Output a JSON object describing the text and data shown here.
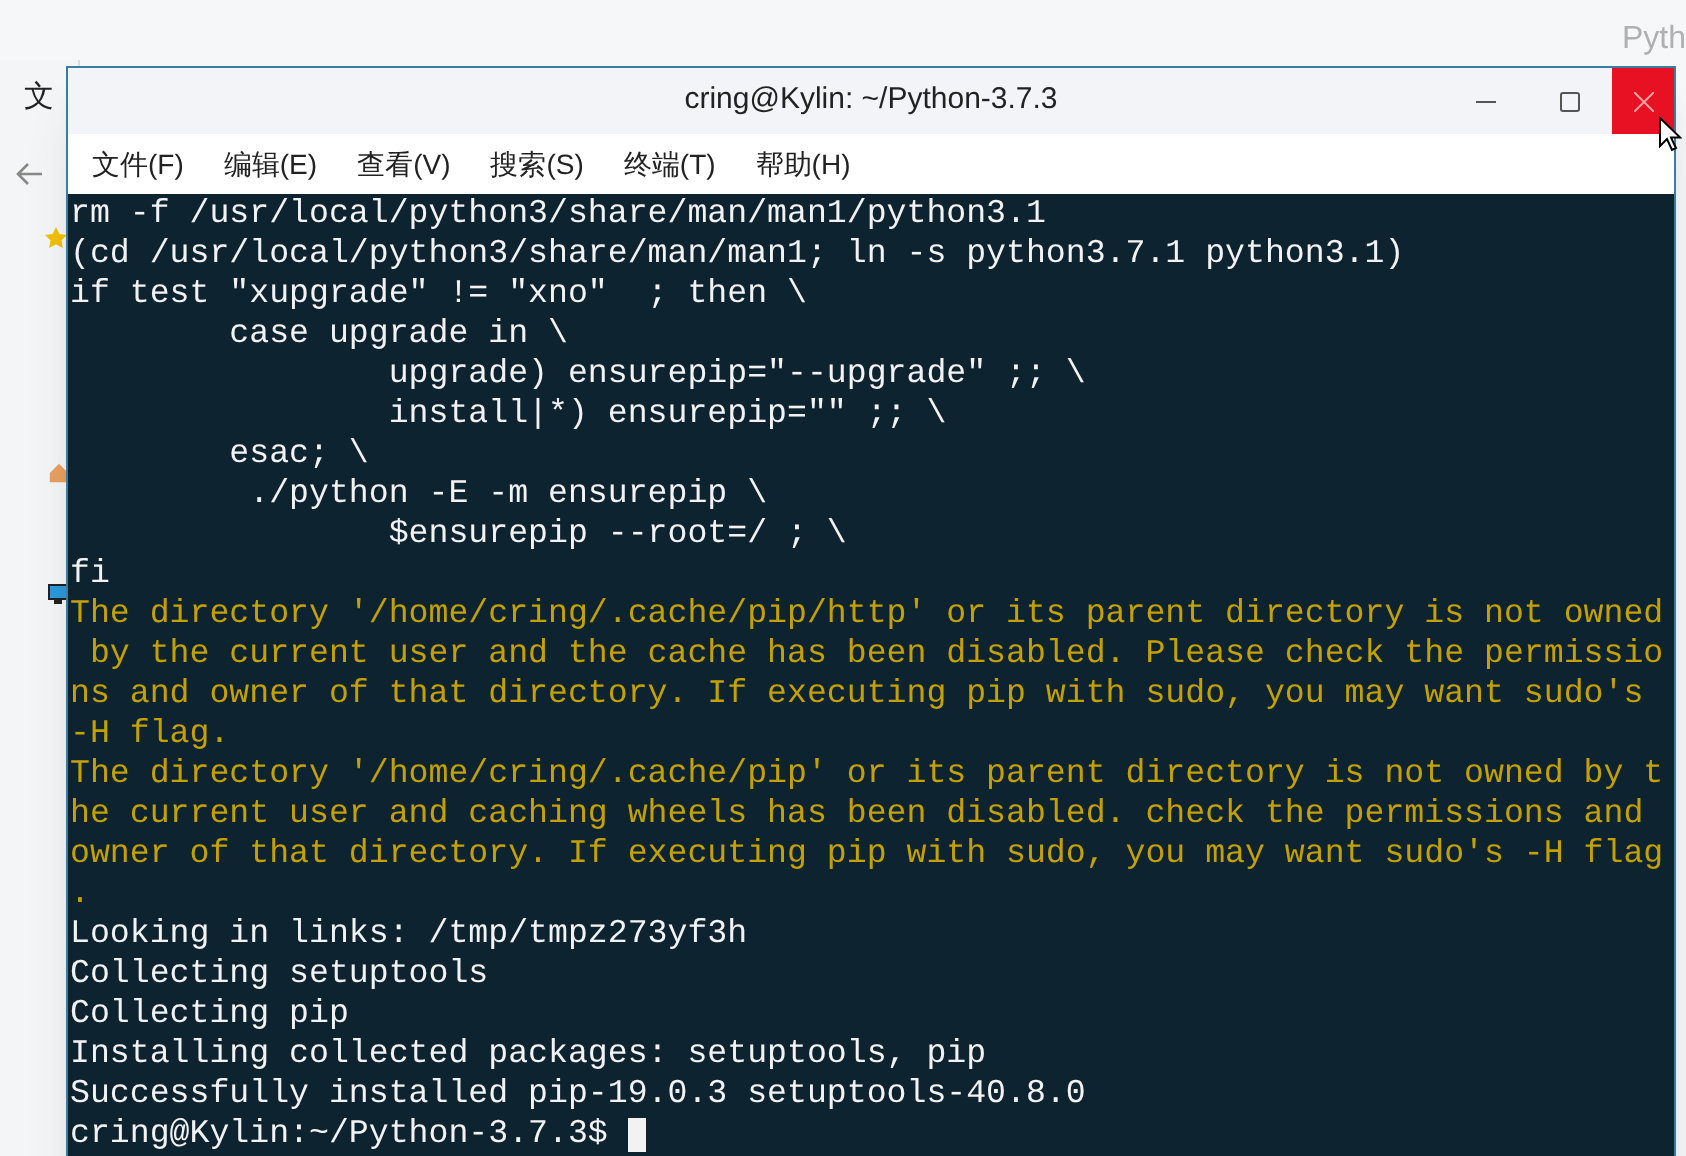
{
  "background_window": {
    "menu_fragment": "文",
    "title_fragment": "Pyth"
  },
  "window": {
    "title": "cring@Kylin: ~/Python-3.7.3"
  },
  "menu": [
    "文件(F)",
    "编辑(E)",
    "查看(V)",
    "搜索(S)",
    "终端(T)",
    "帮助(H)"
  ],
  "terminal": {
    "lines": [
      {
        "kind": "output",
        "text": "rm -f /usr/local/python3/share/man/man1/python3.1"
      },
      {
        "kind": "output",
        "text": "(cd /usr/local/python3/share/man/man1; ln -s python3.7.1 python3.1)"
      },
      {
        "kind": "output",
        "text": "if test \"xupgrade\" != \"xno\"  ; then \\"
      },
      {
        "kind": "output",
        "text": "        case upgrade in \\"
      },
      {
        "kind": "output",
        "text": "                upgrade) ensurepip=\"--upgrade\" ;; \\"
      },
      {
        "kind": "output",
        "text": "                install|*) ensurepip=\"\" ;; \\"
      },
      {
        "kind": "output",
        "text": "        esac; \\"
      },
      {
        "kind": "output",
        "text": "         ./python -E -m ensurepip \\"
      },
      {
        "kind": "output",
        "text": "                $ensurepip --root=/ ; \\"
      },
      {
        "kind": "output",
        "text": "fi"
      },
      {
        "kind": "warning",
        "text": "The directory '/home/cring/.cache/pip/http' or its parent directory is not owned"
      },
      {
        "kind": "warning",
        "text": " by the current user and the cache has been disabled. Please check the permissio"
      },
      {
        "kind": "warning",
        "text": "ns and owner of that directory. If executing pip with sudo, you may want sudo's"
      },
      {
        "kind": "warning",
        "text": "-H flag."
      },
      {
        "kind": "warning",
        "text": "The directory '/home/cring/.cache/pip' or its parent directory is not owned by t"
      },
      {
        "kind": "warning",
        "text": "he current user and caching wheels has been disabled. check the permissions and"
      },
      {
        "kind": "warning",
        "text": "owner of that directory. If executing pip with sudo, you may want sudo's -H flag"
      },
      {
        "kind": "warning",
        "text": "."
      },
      {
        "kind": "output",
        "text": "Looking in links: /tmp/tmpz273yf3h"
      },
      {
        "kind": "output",
        "text": "Collecting setuptools"
      },
      {
        "kind": "output",
        "text": "Collecting pip"
      },
      {
        "kind": "output",
        "text": "Installing collected packages: setuptools, pip"
      },
      {
        "kind": "output",
        "text": "Successfully installed pip-19.0.3 setuptools-40.8.0"
      }
    ],
    "prompt": "cring@Kylin:~/Python-3.7.3$"
  }
}
